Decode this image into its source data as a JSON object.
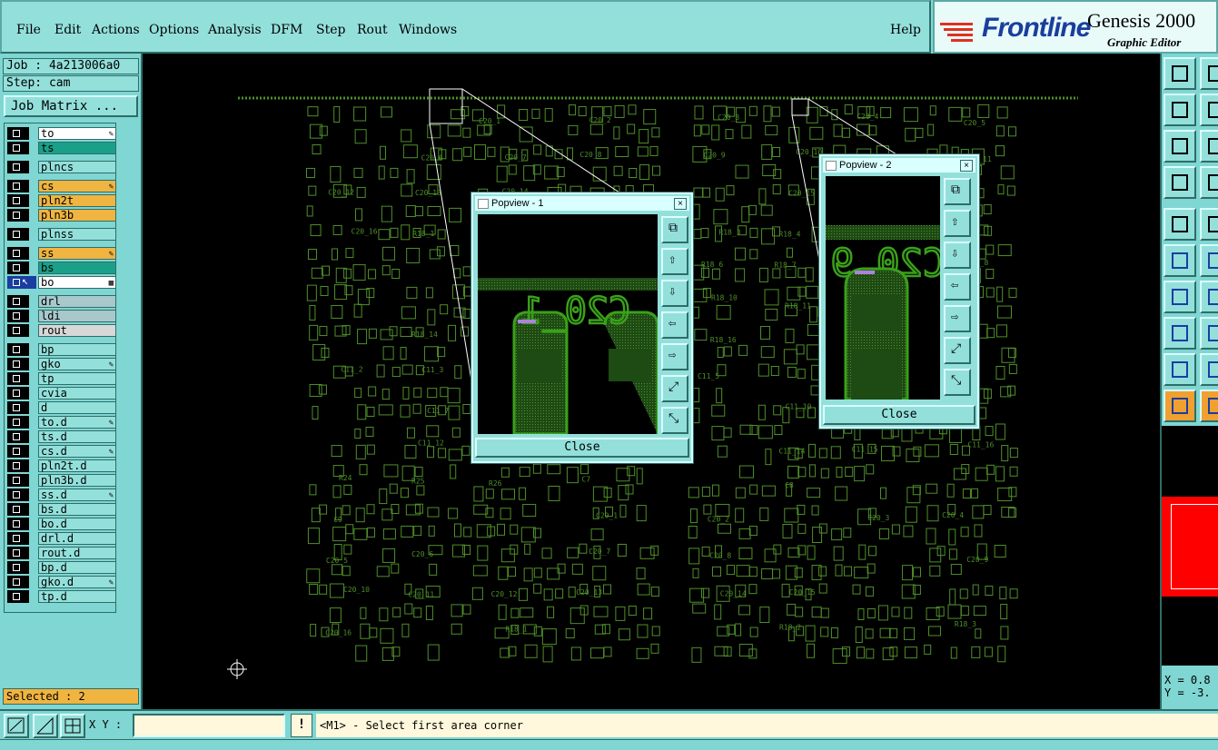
{
  "menubar": {
    "items": [
      "File",
      "Edit",
      "Actions",
      "Options",
      "Analysis",
      "DFM",
      "Step",
      "Rout",
      "Windows"
    ],
    "help": "Help"
  },
  "brand": {
    "logo": "Frontline",
    "title": "Genesis 2000",
    "subtitle": "Graphic Editor"
  },
  "job": {
    "job_label": "Job : 4a213006a0",
    "step_label": "Step: cam",
    "matrix_button": "Job Matrix ..."
  },
  "layers": [
    {
      "name": "to",
      "color": "#ffffff",
      "mark": "pen",
      "group": 0
    },
    {
      "name": "ts",
      "color": "#1aa088",
      "mark": "",
      "group": 0
    },
    {
      "name": "plncs",
      "color": "#93e0db",
      "mark": "",
      "group": 1
    },
    {
      "name": "cs",
      "color": "#f0b440",
      "mark": "pen",
      "group": 2
    },
    {
      "name": "pln2t",
      "color": "#f0b440",
      "mark": "",
      "group": 2
    },
    {
      "name": "pln3b",
      "color": "#f0b440",
      "mark": "",
      "group": 2
    },
    {
      "name": "plnss",
      "color": "#93e0db",
      "mark": "",
      "group": 3
    },
    {
      "name": "ss",
      "color": "#f0b440",
      "mark": "pen",
      "group": 4
    },
    {
      "name": "bs",
      "color": "#1aa088",
      "mark": "",
      "group": 4
    },
    {
      "name": "bo",
      "color": "#ffffff",
      "mark": "grid",
      "group": 4,
      "active": true
    },
    {
      "name": "drl",
      "color": "#a8c8cc",
      "mark": "",
      "group": 5
    },
    {
      "name": "ldi",
      "color": "#a8c8cc",
      "mark": "",
      "group": 5
    },
    {
      "name": "rout",
      "color": "#d8d8d8",
      "mark": "",
      "group": 5
    },
    {
      "name": "bp",
      "color": "#93e0db",
      "mark": "",
      "group": 6
    },
    {
      "name": "gko",
      "color": "#93e0db",
      "mark": "pen",
      "group": 6
    },
    {
      "name": "tp",
      "color": "#93e0db",
      "mark": "",
      "group": 6
    },
    {
      "name": "cvia",
      "color": "#93e0db",
      "mark": "",
      "group": 6
    },
    {
      "name": "d",
      "color": "#93e0db",
      "mark": "",
      "group": 6
    },
    {
      "name": "to.d",
      "color": "#93e0db",
      "mark": "pen",
      "group": 6
    },
    {
      "name": "ts.d",
      "color": "#93e0db",
      "mark": "",
      "group": 6
    },
    {
      "name": "cs.d",
      "color": "#93e0db",
      "mark": "pen",
      "group": 6
    },
    {
      "name": "pln2t.d",
      "color": "#93e0db",
      "mark": "",
      "group": 6
    },
    {
      "name": "pln3b.d",
      "color": "#93e0db",
      "mark": "",
      "group": 6
    },
    {
      "name": "ss.d",
      "color": "#93e0db",
      "mark": "pen",
      "group": 6
    },
    {
      "name": "bs.d",
      "color": "#93e0db",
      "mark": "",
      "group": 6
    },
    {
      "name": "bo.d",
      "color": "#93e0db",
      "mark": "",
      "group": 6
    },
    {
      "name": "drl.d",
      "color": "#93e0db",
      "mark": "",
      "group": 6
    },
    {
      "name": "rout.d",
      "color": "#93e0db",
      "mark": "",
      "group": 6
    },
    {
      "name": "bp.d",
      "color": "#93e0db",
      "mark": "",
      "group": 6
    },
    {
      "name": "gko.d",
      "color": "#93e0db",
      "mark": "pen",
      "group": 6
    },
    {
      "name": "tp.d",
      "color": "#93e0db",
      "mark": "",
      "group": 6
    }
  ],
  "selected_label": "Selected : 2",
  "popview1": {
    "title": "Popview - 1",
    "close": "Close",
    "close_x": "×"
  },
  "popview2": {
    "title": "Popview - 2",
    "close": "Close",
    "close_x": "×"
  },
  "board_labels": [
    "C20_1",
    "C20_2",
    "C20_3",
    "C20_4",
    "C20_5",
    "C20_6",
    "C20_7",
    "C20_8",
    "C20_9",
    "C20_10",
    "C20_11",
    "C20_12",
    "C20_13",
    "C20_14",
    "C20_15",
    "C20_16",
    "R18_1",
    "R18_2",
    "R18_3",
    "R18_4",
    "R18_5",
    "R18_6",
    "R18_7",
    "R18_8",
    "R18_9",
    "R18_10",
    "R18_11",
    "R18_12",
    "R18_13",
    "R18_14",
    "R18_15",
    "R18_16",
    "C11_1",
    "C11_2",
    "C11_3",
    "C11_4",
    "C11_5",
    "C11_6",
    "C11_7",
    "C11_8",
    "C11_9",
    "C11_10",
    "C11_11",
    "C11_12",
    "C11_13",
    "C11_14",
    "C11_15",
    "C11_16",
    "R24",
    "R25",
    "R26",
    "C7",
    "C8",
    "C9"
  ],
  "coords": {
    "x_label": "X = 0.8",
    "y_label": "Y = -3."
  },
  "bottom": {
    "xy_label": "X Y :",
    "xy_value": "",
    "bang": "!",
    "prompt": "<M1> - Select first area corner"
  },
  "colors": {
    "panel": "#7fd6d2",
    "canvas": "#000000",
    "board_green": "#4f8f2a",
    "bright_green": "#3aa01a",
    "preview_red": "#ff0000"
  }
}
